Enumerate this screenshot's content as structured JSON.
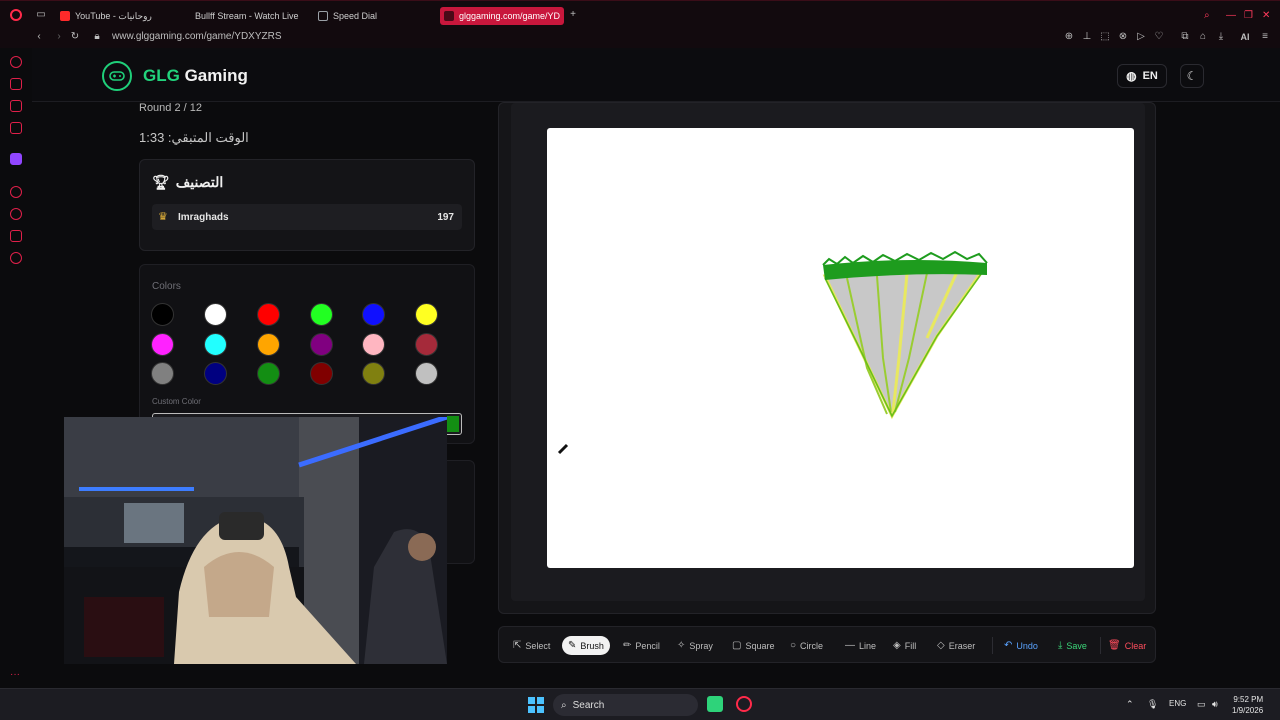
{
  "browser": {
    "tabs": [
      {
        "label": "YouTube - روحانيات",
        "active": false,
        "favicon_color": "#ff2a2a"
      },
      {
        "label": "Bullff Stream - Watch Live",
        "active": false,
        "favicon_color": "#53fc18"
      },
      {
        "label": "Speed Dial",
        "active": false,
        "favicon_color": "#9aa0a6"
      },
      {
        "label": "glggaming.com/game/YD",
        "active": true,
        "favicon_color": "#c8173c"
      }
    ],
    "new_tab": "+",
    "url": "www.glggaming.com/game/YDXYZRS",
    "ai_label": "AI"
  },
  "site": {
    "brand_first": "GLG",
    "brand_second": " Gaming",
    "accent": "#22d37c",
    "lang_label": "EN"
  },
  "game": {
    "round_text": "Round 2 / 12",
    "timer_text": "الوقت المتبقي: 1:33",
    "ranking_title": "التصنيف",
    "players": [
      {
        "name": "Imraghads",
        "score": "197"
      }
    ]
  },
  "palette": {
    "label": "Colors",
    "custom_label": "Custom Color",
    "custom_value": "#138e13",
    "swatches": [
      "#000000",
      "#ffffff",
      "#ff0000",
      "#22ff22",
      "#1010ff",
      "#ffff22",
      "#ff22ff",
      "#22ffff",
      "#ffa500",
      "#800080",
      "#ffb6c1",
      "#a52a3a",
      "#808080",
      "#000080",
      "#138e13",
      "#800000",
      "#808010",
      "#c0c0c0"
    ]
  },
  "toolbar": {
    "select": "Select",
    "brush": "Brush",
    "pencil": "Pencil",
    "spray": "Spray",
    "square": "Square",
    "circle": "Circle",
    "line": "Line",
    "fill": "Fill",
    "eraser": "Eraser",
    "undo": "Undo",
    "save": "Save",
    "clear": "Clear"
  },
  "taskbar": {
    "search": "Search",
    "lang": "ENG",
    "time": "9:52 PM",
    "date": "1/9/2026"
  }
}
